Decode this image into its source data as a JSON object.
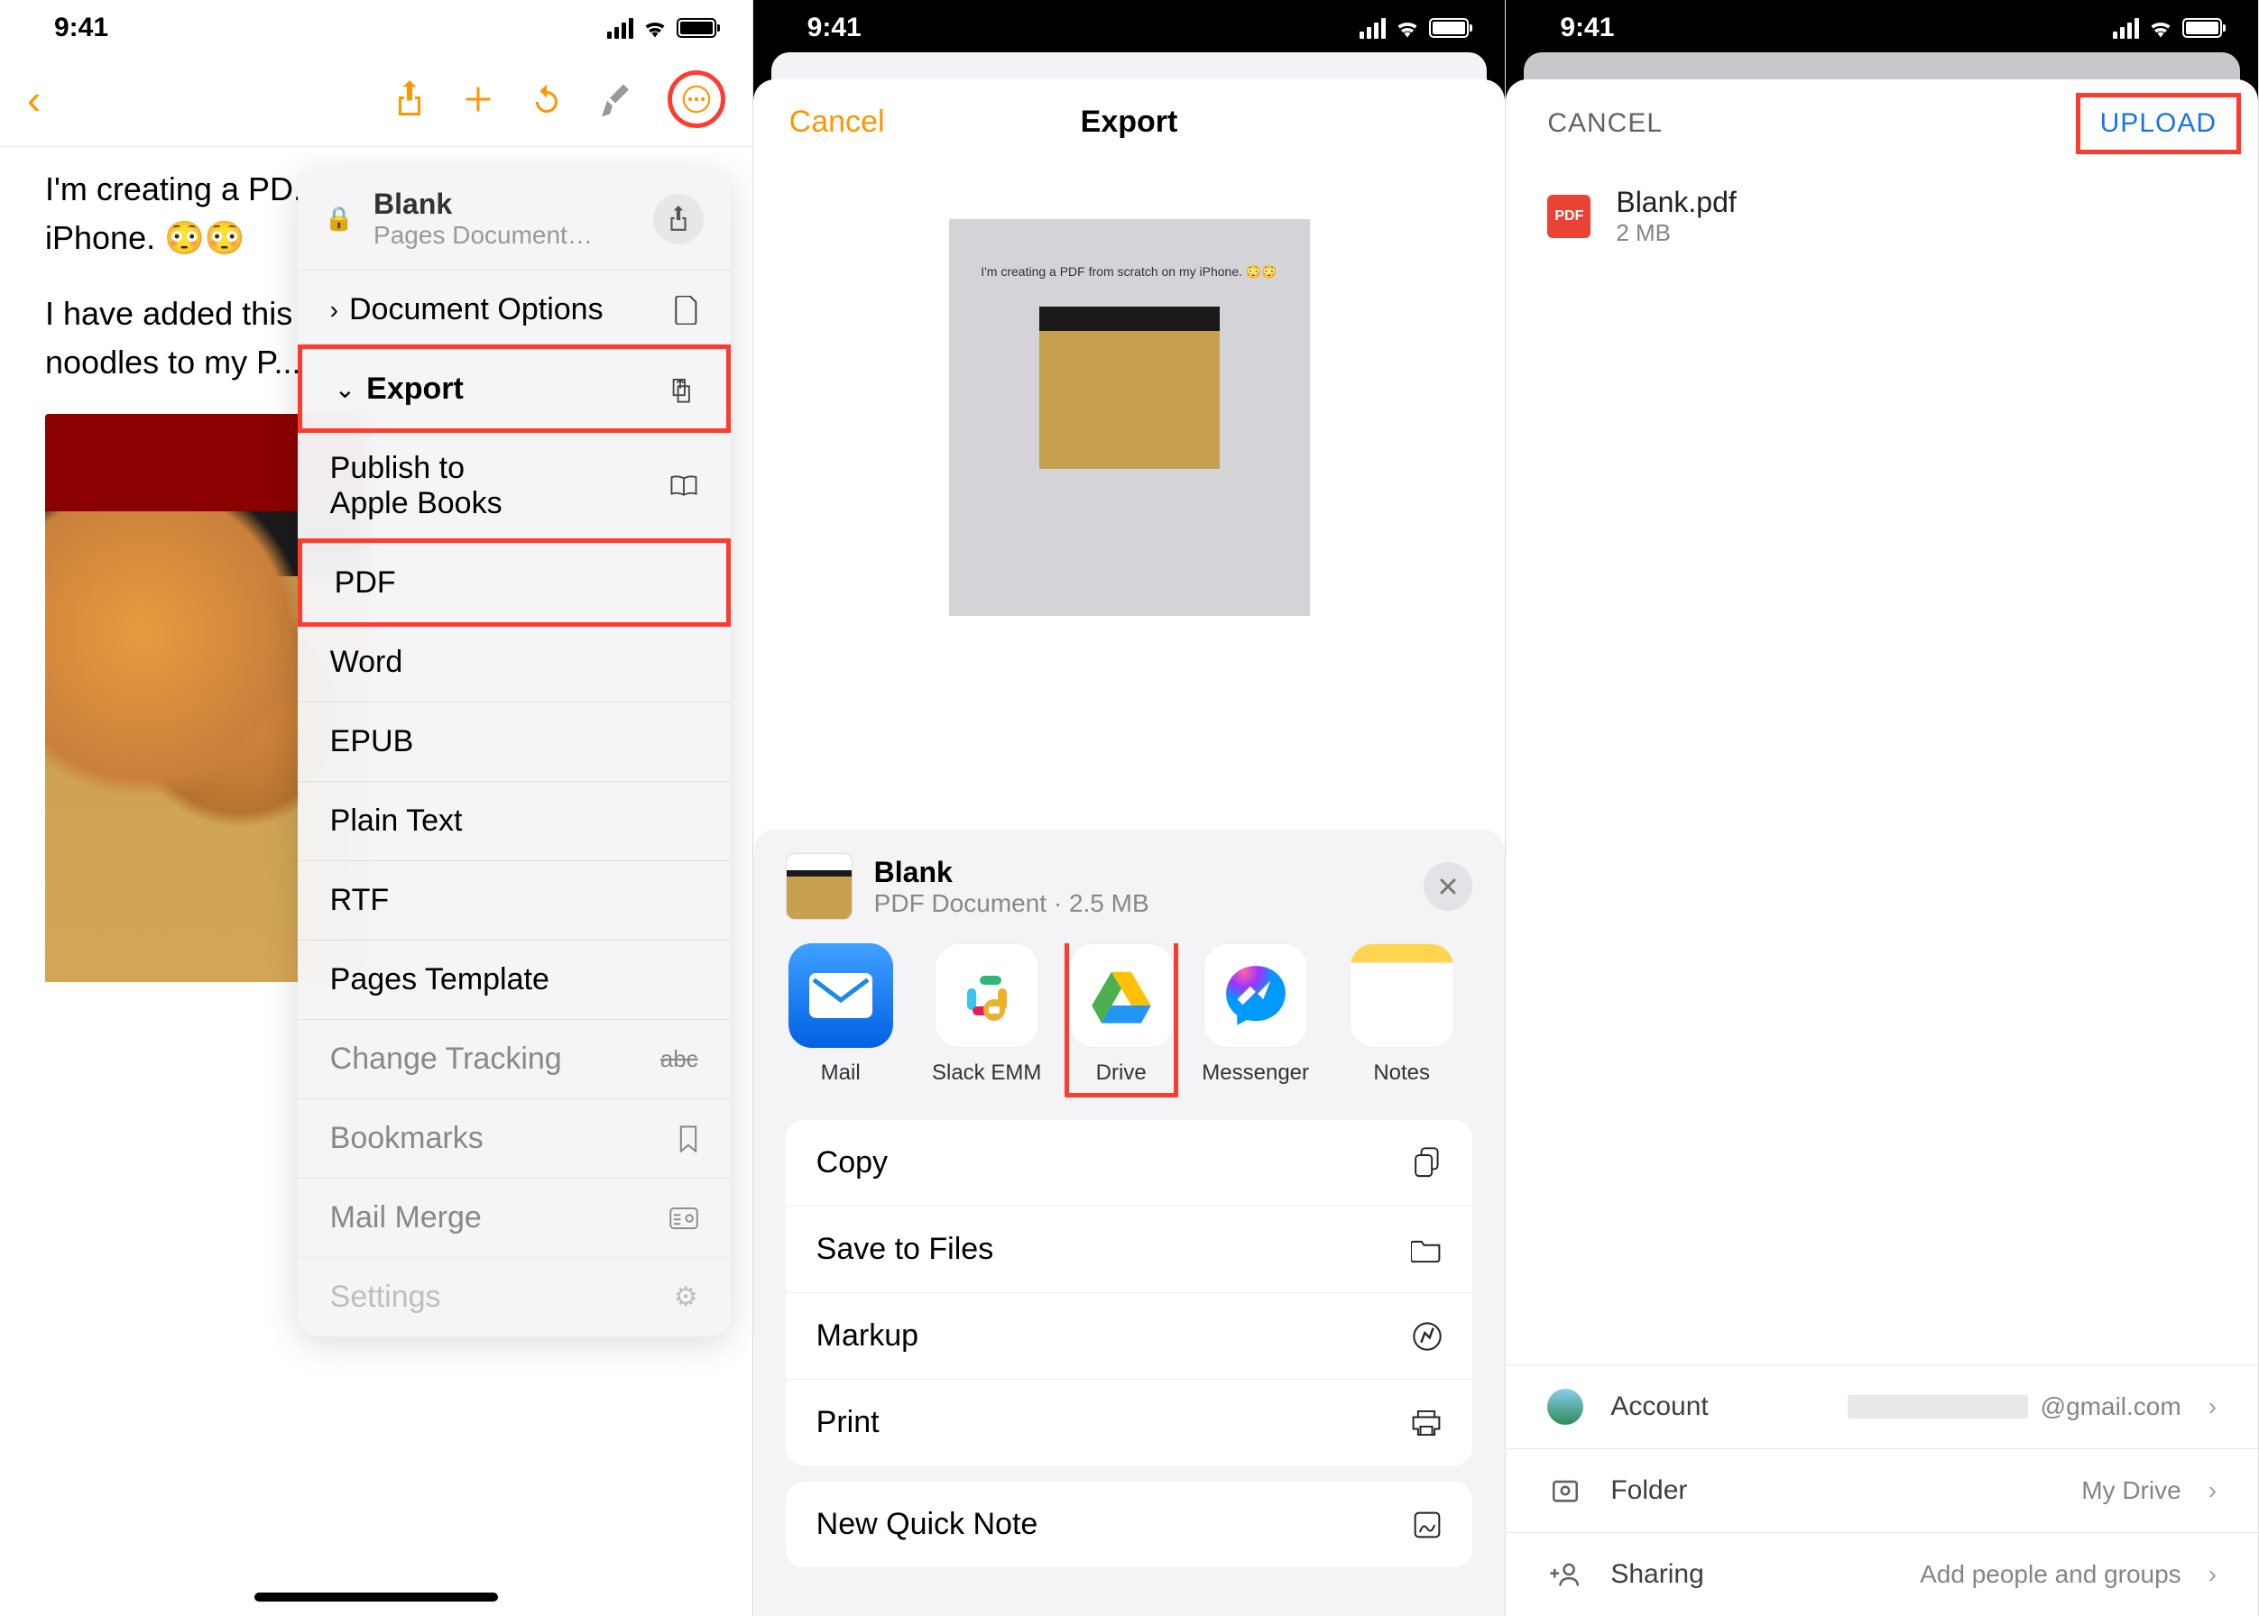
{
  "status": {
    "time": "9:41"
  },
  "screen1": {
    "doc_text_line1": "I'm creating a PD...",
    "doc_text_line2": "iPhone. 😳😳",
    "doc_text_line3": "I have added this",
    "doc_text_line4": "noodles to my P...",
    "dropdown": {
      "title": "Blank",
      "subtitle": "Pages Document…",
      "doc_options": "Document Options",
      "export": "Export",
      "publish": "Publish to\nApple Books",
      "pdf": "PDF",
      "word": "Word",
      "epub": "EPUB",
      "plain": "Plain Text",
      "rtf": "RTF",
      "template": "Pages Template",
      "tracking": "Change Tracking",
      "bookmarks": "Bookmarks",
      "mailmerge": "Mail Merge",
      "settings": "Settings"
    }
  },
  "screen2": {
    "cancel": "Cancel",
    "title": "Export",
    "preview_text": "I'm creating a PDF from scratch on my iPhone. 😳😳",
    "share": {
      "name": "Blank",
      "meta": "PDF Document · 2.5 MB",
      "apps": {
        "mail": "Mail",
        "slack": "Slack EMM",
        "drive": "Drive",
        "messenger": "Messenger",
        "notes": "Notes"
      },
      "actions": {
        "copy": "Copy",
        "save": "Save to Files",
        "markup": "Markup",
        "print": "Print",
        "quicknote": "New Quick Note"
      }
    }
  },
  "screen3": {
    "cancel": "CANCEL",
    "upload": "UPLOAD",
    "file": {
      "name": "Blank.pdf",
      "size": "2 MB",
      "badge": "PDF"
    },
    "rows": {
      "account": "Account",
      "account_val": "@gmail.com",
      "folder": "Folder",
      "folder_val": "My Drive",
      "sharing": "Sharing",
      "sharing_val": "Add people and groups"
    }
  }
}
